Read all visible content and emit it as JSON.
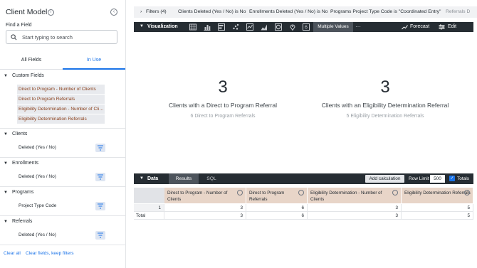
{
  "left_panel": {
    "title": "Client Model",
    "find_label": "Find a Field",
    "search_placeholder": "Start typing to search",
    "tabs": [
      "All Fields",
      "In Use"
    ],
    "active_tab": "In Use",
    "sections": {
      "custom_fields": {
        "label": "Custom Fields",
        "items": [
          "Direct to Program - Number of Clients",
          "Direct to Program Referrals",
          "Eligibility Determination - Number of Clients",
          "Eligibility Determination Referrals"
        ]
      },
      "clients": {
        "label": "Clients",
        "item": "Deleted (Yes / No)"
      },
      "enrollments": {
        "label": "Enrollments",
        "item": "Deleted (Yes / No)"
      },
      "programs": {
        "label": "Programs",
        "item": "Project Type Code"
      },
      "referrals": {
        "label": "Referrals",
        "item": "Deleted (Yes / No)"
      }
    },
    "footer": {
      "clear_all": "Clear all",
      "clear_fields": "Clear fields, keep filters"
    }
  },
  "filters": {
    "label": "Filters (4)",
    "items": [
      {
        "field": "Clients Deleted (Yes / No)",
        "op": "is",
        "value": "No"
      },
      {
        "field": "Enrollments Deleted (Yes / No)",
        "op": "is",
        "value": "No"
      },
      {
        "field": "Programs Project Type Code",
        "op": "is",
        "value": "\"Coordinated Entry\""
      },
      {
        "field": "Referrals D",
        "op": "",
        "value": ""
      }
    ]
  },
  "visualization": {
    "title": "Visualization",
    "multiple_values": "Multiple Values",
    "forecast": "Forecast",
    "edit": "Edit",
    "icons": [
      "table-icon",
      "bar-chart-icon",
      "column-chart-icon",
      "scatter-icon",
      "line-icon",
      "area-icon",
      "pie-icon",
      "map-pin-icon",
      "single-value-icon"
    ],
    "metrics": [
      {
        "value": "3",
        "label": "Clients with a Direct to Program Referral",
        "sub": "6 Direct to Program Referrals"
      },
      {
        "value": "3",
        "label": "Clients with an Eligibility Determination Referral",
        "sub": "5 Eligibility Determination Referrals"
      }
    ]
  },
  "data_panel": {
    "title": "Data",
    "tabs": [
      "Results",
      "SQL"
    ],
    "add_calculation": "Add calculation",
    "row_limit_label": "Row Limit",
    "row_limit": "500",
    "totals_label": "Totals",
    "columns": [
      "Direct to Program - Number of Clients",
      "Direct to Program Referrals",
      "Eligibility Determination - Number of Clients",
      "Eligibility Determination Referrals"
    ],
    "rows": [
      {
        "num": "1",
        "values": [
          "3",
          "6",
          "3",
          "5"
        ]
      }
    ],
    "total_label": "Total",
    "totals": [
      "3",
      "6",
      "3",
      "5"
    ]
  },
  "colors": {
    "accent": "#1a73e8",
    "dark_bar": "#262d33",
    "dimension_bg": "#e8d5c8",
    "custom_field_text": "#8a3f1a"
  }
}
